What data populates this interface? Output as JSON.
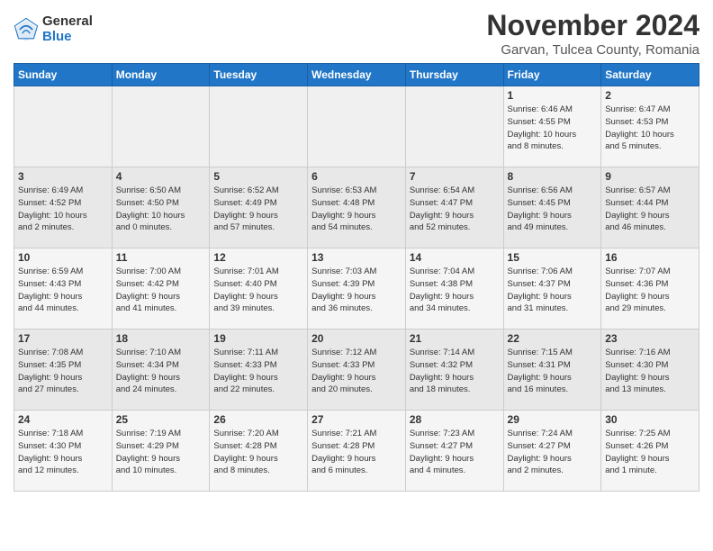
{
  "logo": {
    "general": "General",
    "blue": "Blue"
  },
  "title": {
    "month": "November 2024",
    "location": "Garvan, Tulcea County, Romania"
  },
  "weekdays": [
    "Sunday",
    "Monday",
    "Tuesday",
    "Wednesday",
    "Thursday",
    "Friday",
    "Saturday"
  ],
  "weeks": [
    [
      {
        "day": "",
        "info": ""
      },
      {
        "day": "",
        "info": ""
      },
      {
        "day": "",
        "info": ""
      },
      {
        "day": "",
        "info": ""
      },
      {
        "day": "",
        "info": ""
      },
      {
        "day": "1",
        "info": "Sunrise: 6:46 AM\nSunset: 4:55 PM\nDaylight: 10 hours\nand 8 minutes."
      },
      {
        "day": "2",
        "info": "Sunrise: 6:47 AM\nSunset: 4:53 PM\nDaylight: 10 hours\nand 5 minutes."
      }
    ],
    [
      {
        "day": "3",
        "info": "Sunrise: 6:49 AM\nSunset: 4:52 PM\nDaylight: 10 hours\nand 2 minutes."
      },
      {
        "day": "4",
        "info": "Sunrise: 6:50 AM\nSunset: 4:50 PM\nDaylight: 10 hours\nand 0 minutes."
      },
      {
        "day": "5",
        "info": "Sunrise: 6:52 AM\nSunset: 4:49 PM\nDaylight: 9 hours\nand 57 minutes."
      },
      {
        "day": "6",
        "info": "Sunrise: 6:53 AM\nSunset: 4:48 PM\nDaylight: 9 hours\nand 54 minutes."
      },
      {
        "day": "7",
        "info": "Sunrise: 6:54 AM\nSunset: 4:47 PM\nDaylight: 9 hours\nand 52 minutes."
      },
      {
        "day": "8",
        "info": "Sunrise: 6:56 AM\nSunset: 4:45 PM\nDaylight: 9 hours\nand 49 minutes."
      },
      {
        "day": "9",
        "info": "Sunrise: 6:57 AM\nSunset: 4:44 PM\nDaylight: 9 hours\nand 46 minutes."
      }
    ],
    [
      {
        "day": "10",
        "info": "Sunrise: 6:59 AM\nSunset: 4:43 PM\nDaylight: 9 hours\nand 44 minutes."
      },
      {
        "day": "11",
        "info": "Sunrise: 7:00 AM\nSunset: 4:42 PM\nDaylight: 9 hours\nand 41 minutes."
      },
      {
        "day": "12",
        "info": "Sunrise: 7:01 AM\nSunset: 4:40 PM\nDaylight: 9 hours\nand 39 minutes."
      },
      {
        "day": "13",
        "info": "Sunrise: 7:03 AM\nSunset: 4:39 PM\nDaylight: 9 hours\nand 36 minutes."
      },
      {
        "day": "14",
        "info": "Sunrise: 7:04 AM\nSunset: 4:38 PM\nDaylight: 9 hours\nand 34 minutes."
      },
      {
        "day": "15",
        "info": "Sunrise: 7:06 AM\nSunset: 4:37 PM\nDaylight: 9 hours\nand 31 minutes."
      },
      {
        "day": "16",
        "info": "Sunrise: 7:07 AM\nSunset: 4:36 PM\nDaylight: 9 hours\nand 29 minutes."
      }
    ],
    [
      {
        "day": "17",
        "info": "Sunrise: 7:08 AM\nSunset: 4:35 PM\nDaylight: 9 hours\nand 27 minutes."
      },
      {
        "day": "18",
        "info": "Sunrise: 7:10 AM\nSunset: 4:34 PM\nDaylight: 9 hours\nand 24 minutes."
      },
      {
        "day": "19",
        "info": "Sunrise: 7:11 AM\nSunset: 4:33 PM\nDaylight: 9 hours\nand 22 minutes."
      },
      {
        "day": "20",
        "info": "Sunrise: 7:12 AM\nSunset: 4:33 PM\nDaylight: 9 hours\nand 20 minutes."
      },
      {
        "day": "21",
        "info": "Sunrise: 7:14 AM\nSunset: 4:32 PM\nDaylight: 9 hours\nand 18 minutes."
      },
      {
        "day": "22",
        "info": "Sunrise: 7:15 AM\nSunset: 4:31 PM\nDaylight: 9 hours\nand 16 minutes."
      },
      {
        "day": "23",
        "info": "Sunrise: 7:16 AM\nSunset: 4:30 PM\nDaylight: 9 hours\nand 13 minutes."
      }
    ],
    [
      {
        "day": "24",
        "info": "Sunrise: 7:18 AM\nSunset: 4:30 PM\nDaylight: 9 hours\nand 12 minutes."
      },
      {
        "day": "25",
        "info": "Sunrise: 7:19 AM\nSunset: 4:29 PM\nDaylight: 9 hours\nand 10 minutes."
      },
      {
        "day": "26",
        "info": "Sunrise: 7:20 AM\nSunset: 4:28 PM\nDaylight: 9 hours\nand 8 minutes."
      },
      {
        "day": "27",
        "info": "Sunrise: 7:21 AM\nSunset: 4:28 PM\nDaylight: 9 hours\nand 6 minutes."
      },
      {
        "day": "28",
        "info": "Sunrise: 7:23 AM\nSunset: 4:27 PM\nDaylight: 9 hours\nand 4 minutes."
      },
      {
        "day": "29",
        "info": "Sunrise: 7:24 AM\nSunset: 4:27 PM\nDaylight: 9 hours\nand 2 minutes."
      },
      {
        "day": "30",
        "info": "Sunrise: 7:25 AM\nSunset: 4:26 PM\nDaylight: 9 hours\nand 1 minute."
      }
    ]
  ]
}
